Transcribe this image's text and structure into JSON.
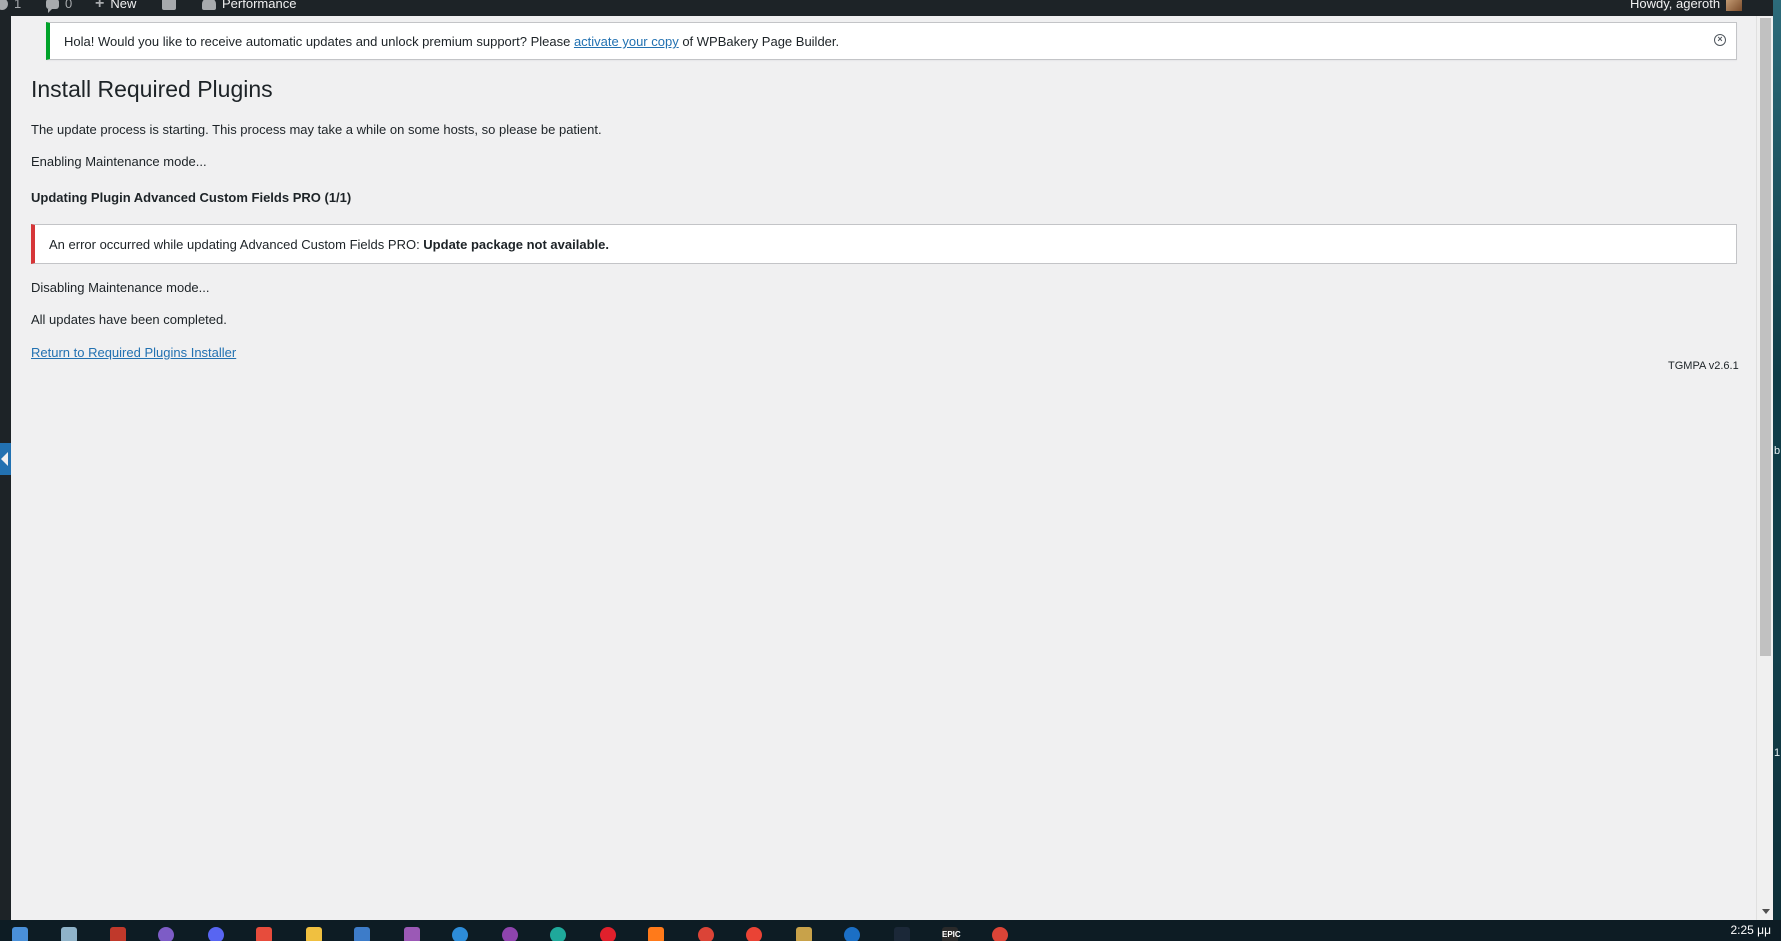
{
  "admin_bar": {
    "comments_count": "0",
    "new_label": "New",
    "performance_label": "Performance",
    "greeting": "Howdy, ageroth"
  },
  "notice": {
    "text_before": "Hola! Would you like to receive automatic updates and unlock premium support? Please ",
    "link_text": "activate your copy",
    "text_after": " of WPBakery Page Builder."
  },
  "page": {
    "title": "Install Required Plugins",
    "starting_text": "The update process is starting. This process may take a while on some hosts, so please be patient.",
    "enabling_text": "Enabling Maintenance mode...",
    "updating_heading": "Updating Plugin Advanced Custom Fields PRO (1/1)",
    "error_prefix": "An error occurred while updating Advanced Custom Fields PRO: ",
    "error_strong": "Update package not available.",
    "disabling_text": "Disabling Maintenance mode...",
    "completed_text": "All updates have been completed.",
    "return_link": "Return to Required Plugins Installer",
    "version": "TGMPA v2.6.1"
  },
  "desktop": {
    "right_fragment_1": "b",
    "right_fragment_2": "1."
  },
  "taskbar": {
    "clock": "2:25 μμ",
    "epic_label": "EPIC",
    "icons": [
      {
        "name": "start-icon",
        "color": "#4a90d9"
      },
      {
        "name": "files-icon",
        "color": "#8fb3c9"
      },
      {
        "name": "tool-icon",
        "color": "#c0392b"
      },
      {
        "name": "viber-icon",
        "color": "#7d5cc6"
      },
      {
        "name": "discord-icon",
        "color": "#5865f2"
      },
      {
        "name": "app-red-icon",
        "color": "#e74c3c"
      },
      {
        "name": "notes-icon",
        "color": "#f0c040"
      },
      {
        "name": "network-icon",
        "color": "#3d7cc9"
      },
      {
        "name": "vs-icon",
        "color": "#9b59b6"
      },
      {
        "name": "mail-icon",
        "color": "#2d8cd8"
      },
      {
        "name": "podcast-icon",
        "color": "#8e44ad"
      },
      {
        "name": "edge-icon",
        "color": "#1fa99b"
      },
      {
        "name": "opera-icon",
        "color": "#e0202c"
      },
      {
        "name": "firefox-icon",
        "color": "#ff7a1a"
      },
      {
        "name": "chrome-icon",
        "color": "#db4437"
      },
      {
        "name": "chrome-2-icon",
        "color": "#ea4335"
      },
      {
        "name": "game-icon",
        "color": "#c8a24a"
      },
      {
        "name": "edge-2-icon",
        "color": "#1b6fc5"
      },
      {
        "name": "steam-icon",
        "color": "#1b2838"
      },
      {
        "name": "epic-icon",
        "color": "#2a2a2a"
      },
      {
        "name": "chrome-3-icon",
        "color": "#db4437"
      }
    ]
  }
}
